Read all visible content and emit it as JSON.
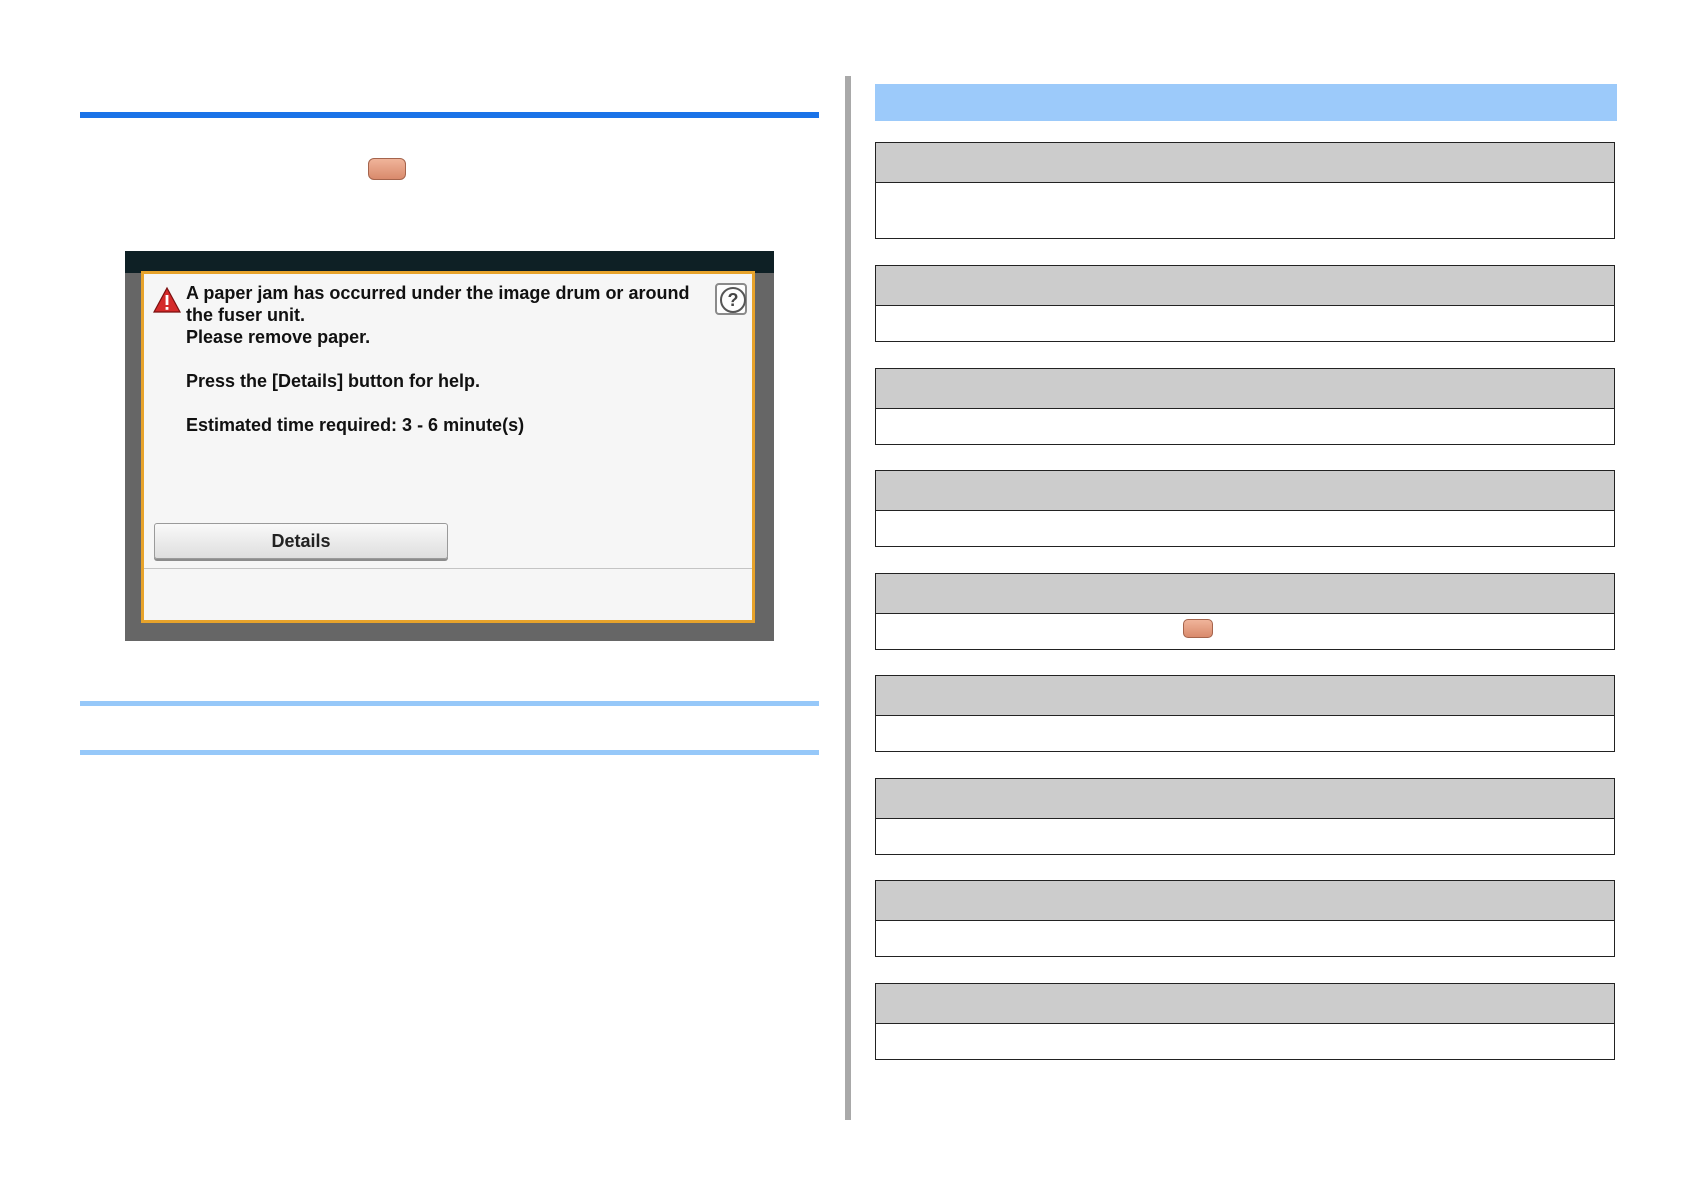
{
  "dialog": {
    "message_lines": [
      "A paper jam has occurred under the image drum or around",
      "the fuser unit.",
      "Please remove paper."
    ],
    "help_line": "Press the [Details] button for help.",
    "time_line": "Estimated time required: 3 - 6 minute(s)",
    "details_label": "Details",
    "help_glyph": "?"
  },
  "icons": {
    "warning": "warning-triangle-icon",
    "help": "help-question-icon",
    "key": "key-button-icon"
  },
  "colors": {
    "accent_blue": "#1a73e8",
    "light_blue": "#96c8f9",
    "dialog_border": "#e7a32b",
    "key_button": "#e39f84"
  }
}
